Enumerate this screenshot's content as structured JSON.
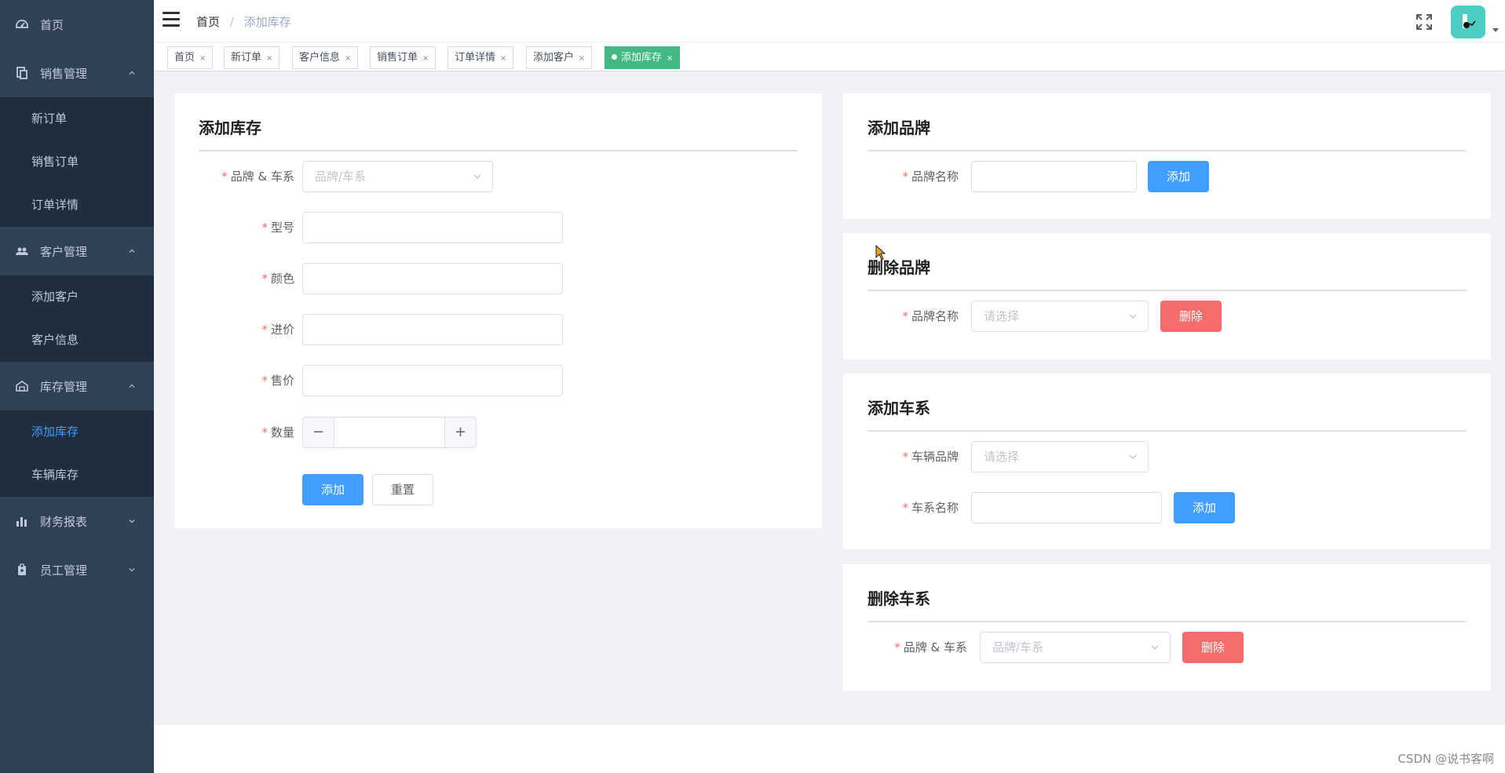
{
  "sidebar": {
    "items": [
      {
        "label": "首页",
        "icon": "dashboard-icon"
      },
      {
        "label": "销售管理",
        "icon": "document-icon",
        "children": [
          "新订单",
          "销售订单",
          "订单详情"
        ]
      },
      {
        "label": "客户管理",
        "icon": "people-icon",
        "children": [
          "添加客户",
          "客户信息"
        ]
      },
      {
        "label": "库存管理",
        "icon": "warehouse-icon",
        "children": [
          "添加库存",
          "车辆库存"
        ]
      },
      {
        "label": "财务报表",
        "icon": "chart-icon"
      },
      {
        "label": "员工管理",
        "icon": "badge-icon"
      }
    ],
    "active_child": "添加库存",
    "colors": {
      "bg": "#304156",
      "sub_bg": "#1f2d3d",
      "text": "#bfcbd9",
      "active": "#409eff"
    }
  },
  "navbar": {
    "breadcrumb": {
      "home": "首页",
      "separator": "/",
      "current": "添加库存"
    }
  },
  "tags": [
    {
      "label": "首页",
      "active": false
    },
    {
      "label": "新订单",
      "active": false
    },
    {
      "label": "客户信息",
      "active": false
    },
    {
      "label": "销售订单",
      "active": false
    },
    {
      "label": "订单详情",
      "active": false
    },
    {
      "label": "添加客户",
      "active": false
    },
    {
      "label": "添加库存",
      "active": true
    }
  ],
  "tag_close": "×",
  "add_inventory": {
    "title": "添加库存",
    "brand_series_label": "品牌 & 车系",
    "brand_series_placeholder": "品牌/车系",
    "model_label": "型号",
    "color_label": "颜色",
    "purchase_price_label": "进价",
    "sale_price_label": "售价",
    "quantity_label": "数量",
    "minus": "−",
    "plus": "+",
    "add_button": "添加",
    "reset_button": "重置"
  },
  "add_brand": {
    "title": "添加品牌",
    "name_label": "品牌名称",
    "add_button": "添加"
  },
  "delete_brand": {
    "title": "删除品牌",
    "name_label": "品牌名称",
    "placeholder": "请选择",
    "delete_button": "删除"
  },
  "add_series": {
    "title": "添加车系",
    "brand_label": "车辆品牌",
    "brand_placeholder": "请选择",
    "series_label": "车系名称",
    "add_button": "添加"
  },
  "delete_series": {
    "title": "删除车系",
    "brand_series_label": "品牌 & 车系",
    "placeholder": "品牌/车系",
    "delete_button": "删除"
  },
  "required_mark": "*",
  "watermark": "CSDN @说书客啊",
  "colors": {
    "primary": "#409eff",
    "danger": "#f56c6c",
    "tag_active": "#42b983",
    "main_bg": "#f0f2f5"
  }
}
